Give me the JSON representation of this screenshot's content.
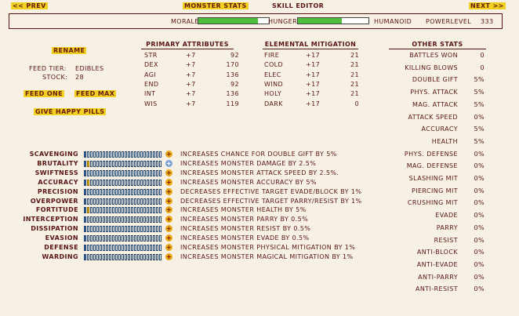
{
  "nav": {
    "prev": "<< PREV",
    "title": "MONSTER STATS",
    "skill_editor": "SKILL EDITOR",
    "next": "NEXT >>"
  },
  "header": {
    "morale_label": "MORALE",
    "morale_value": 0.84,
    "hunger_label": "HUNGER",
    "hunger_value": 0.62,
    "type": "HUMANOID",
    "powerlevel_label": "POWERLEVEL",
    "powerlevel_value": "333"
  },
  "left": {
    "rename": "RENAME",
    "feed_tier_label": "FEED TIER:",
    "feed_tier_value": "EDIBLES",
    "stock_label": "STOCK:",
    "stock_value": "28",
    "feed_one": "FEED ONE",
    "feed_max": "FEED MAX",
    "give_happy_pills": "GIVE HAPPY PILLS"
  },
  "primary": {
    "title": "PRIMARY ATTRIBUTES",
    "rows": [
      {
        "name": "STR",
        "mod": "+7",
        "value": "92"
      },
      {
        "name": "DEX",
        "mod": "+7",
        "value": "170"
      },
      {
        "name": "AGI",
        "mod": "+7",
        "value": "136"
      },
      {
        "name": "END",
        "mod": "+7",
        "value": "92"
      },
      {
        "name": "INT",
        "mod": "+7",
        "value": "136"
      },
      {
        "name": "WIS",
        "mod": "+7",
        "value": "119"
      }
    ]
  },
  "elemental": {
    "title": "ELEMENTAL MITIGATION",
    "rows": [
      {
        "name": "FIRE",
        "mod": "+17",
        "value": "21"
      },
      {
        "name": "COLD",
        "mod": "+17",
        "value": "21"
      },
      {
        "name": "ELEC",
        "mod": "+17",
        "value": "21"
      },
      {
        "name": "WIND",
        "mod": "+17",
        "value": "21"
      },
      {
        "name": "HOLY",
        "mod": "+17",
        "value": "21"
      },
      {
        "name": "DARK",
        "mod": "+17",
        "value": "0"
      }
    ]
  },
  "other": {
    "title": "OTHER STATS",
    "rows": [
      {
        "name": "BATTLES WON",
        "value": "0"
      },
      {
        "name": "KILLING BLOWS",
        "value": "0"
      },
      {
        "name": "DOUBLE GIFT",
        "value": "5%"
      },
      {
        "name": "PHYS. ATTACK",
        "value": "5%"
      },
      {
        "name": "MAG. ATTACK",
        "value": "5%"
      },
      {
        "name": "ATTACK SPEED",
        "value": "0%"
      },
      {
        "name": "ACCURACY",
        "value": "5%"
      },
      {
        "name": "HEALTH",
        "value": "5%"
      },
      {
        "name": "PHYS. DEFENSE",
        "value": "0%"
      },
      {
        "name": "MAG. DEFENSE",
        "value": "0%"
      },
      {
        "name": "SLASHING MIT",
        "value": "0%"
      },
      {
        "name": "PIERCING MIT",
        "value": "0%"
      },
      {
        "name": "CRUSHING MIT",
        "value": "0%"
      },
      {
        "name": "EVADE",
        "value": "0%"
      },
      {
        "name": "PARRY",
        "value": "0%"
      },
      {
        "name": "RESIST",
        "value": "0%"
      },
      {
        "name": "ANTI-BLOCK",
        "value": "0%"
      },
      {
        "name": "ANTI-EVADE",
        "value": "0%"
      },
      {
        "name": "ANTI-PARRY",
        "value": "0%"
      },
      {
        "name": "ANTI-RESIST",
        "value": "0%"
      }
    ]
  },
  "skills": [
    {
      "name": "SCAVENGING",
      "level": 1,
      "max": 25,
      "plus": "+",
      "desc": "INCREASES CHANCE FOR DOUBLE GIFT BY 5%"
    },
    {
      "name": "BRUTALITY",
      "level": 2,
      "max": 25,
      "plus": "+",
      "desc": "INCREASES MONSTER DAMAGE BY 2.5%"
    },
    {
      "name": "SWIFTNESS",
      "level": 1,
      "max": 25,
      "plus": "+",
      "desc": "INCREASES MONSTER ATTACK SPEED BY 2.5%."
    },
    {
      "name": "ACCURACY",
      "level": 2,
      "max": 25,
      "plus": "+",
      "desc": "INCREASES MONSTER ACCURACY BY 5%"
    },
    {
      "name": "PRECISION",
      "level": 1,
      "max": 25,
      "plus": "+",
      "desc": "DECREASES EFFECTIVE TARGET EVADE/BLOCK BY 1%"
    },
    {
      "name": "OVERPOWER",
      "level": 1,
      "max": 25,
      "plus": "+",
      "desc": "DECREASES EFFECTIVE TARGET PARRY/RESIST BY 1%"
    },
    {
      "name": "FORTITUDE",
      "level": 2,
      "max": 25,
      "plus": "+",
      "desc": "INCREASES MONSTER HEALTH BY 5%"
    },
    {
      "name": "INTERCEPTION",
      "level": 1,
      "max": 25,
      "plus": "+",
      "desc": "INCREASES MONSTER PARRY BY 0.5%"
    },
    {
      "name": "DISSIPATION",
      "level": 1,
      "max": 25,
      "plus": "+",
      "desc": "INCREASES MONSTER RESIST BY 0.5%"
    },
    {
      "name": "EVASION",
      "level": 1,
      "max": 25,
      "plus": "+",
      "desc": "INCREASES MONSTER EVADE BY 0.5%"
    },
    {
      "name": "DEFENSE",
      "level": 1,
      "max": 25,
      "plus": "+",
      "desc": "INCREASES MONSTER PHYSICAL MITIGATION BY 1%"
    },
    {
      "name": "WARDING",
      "level": 1,
      "max": 25,
      "plus": "+",
      "desc": "INCREASES MONSTER MAGICAL MITIGATION BY 1%"
    }
  ]
}
